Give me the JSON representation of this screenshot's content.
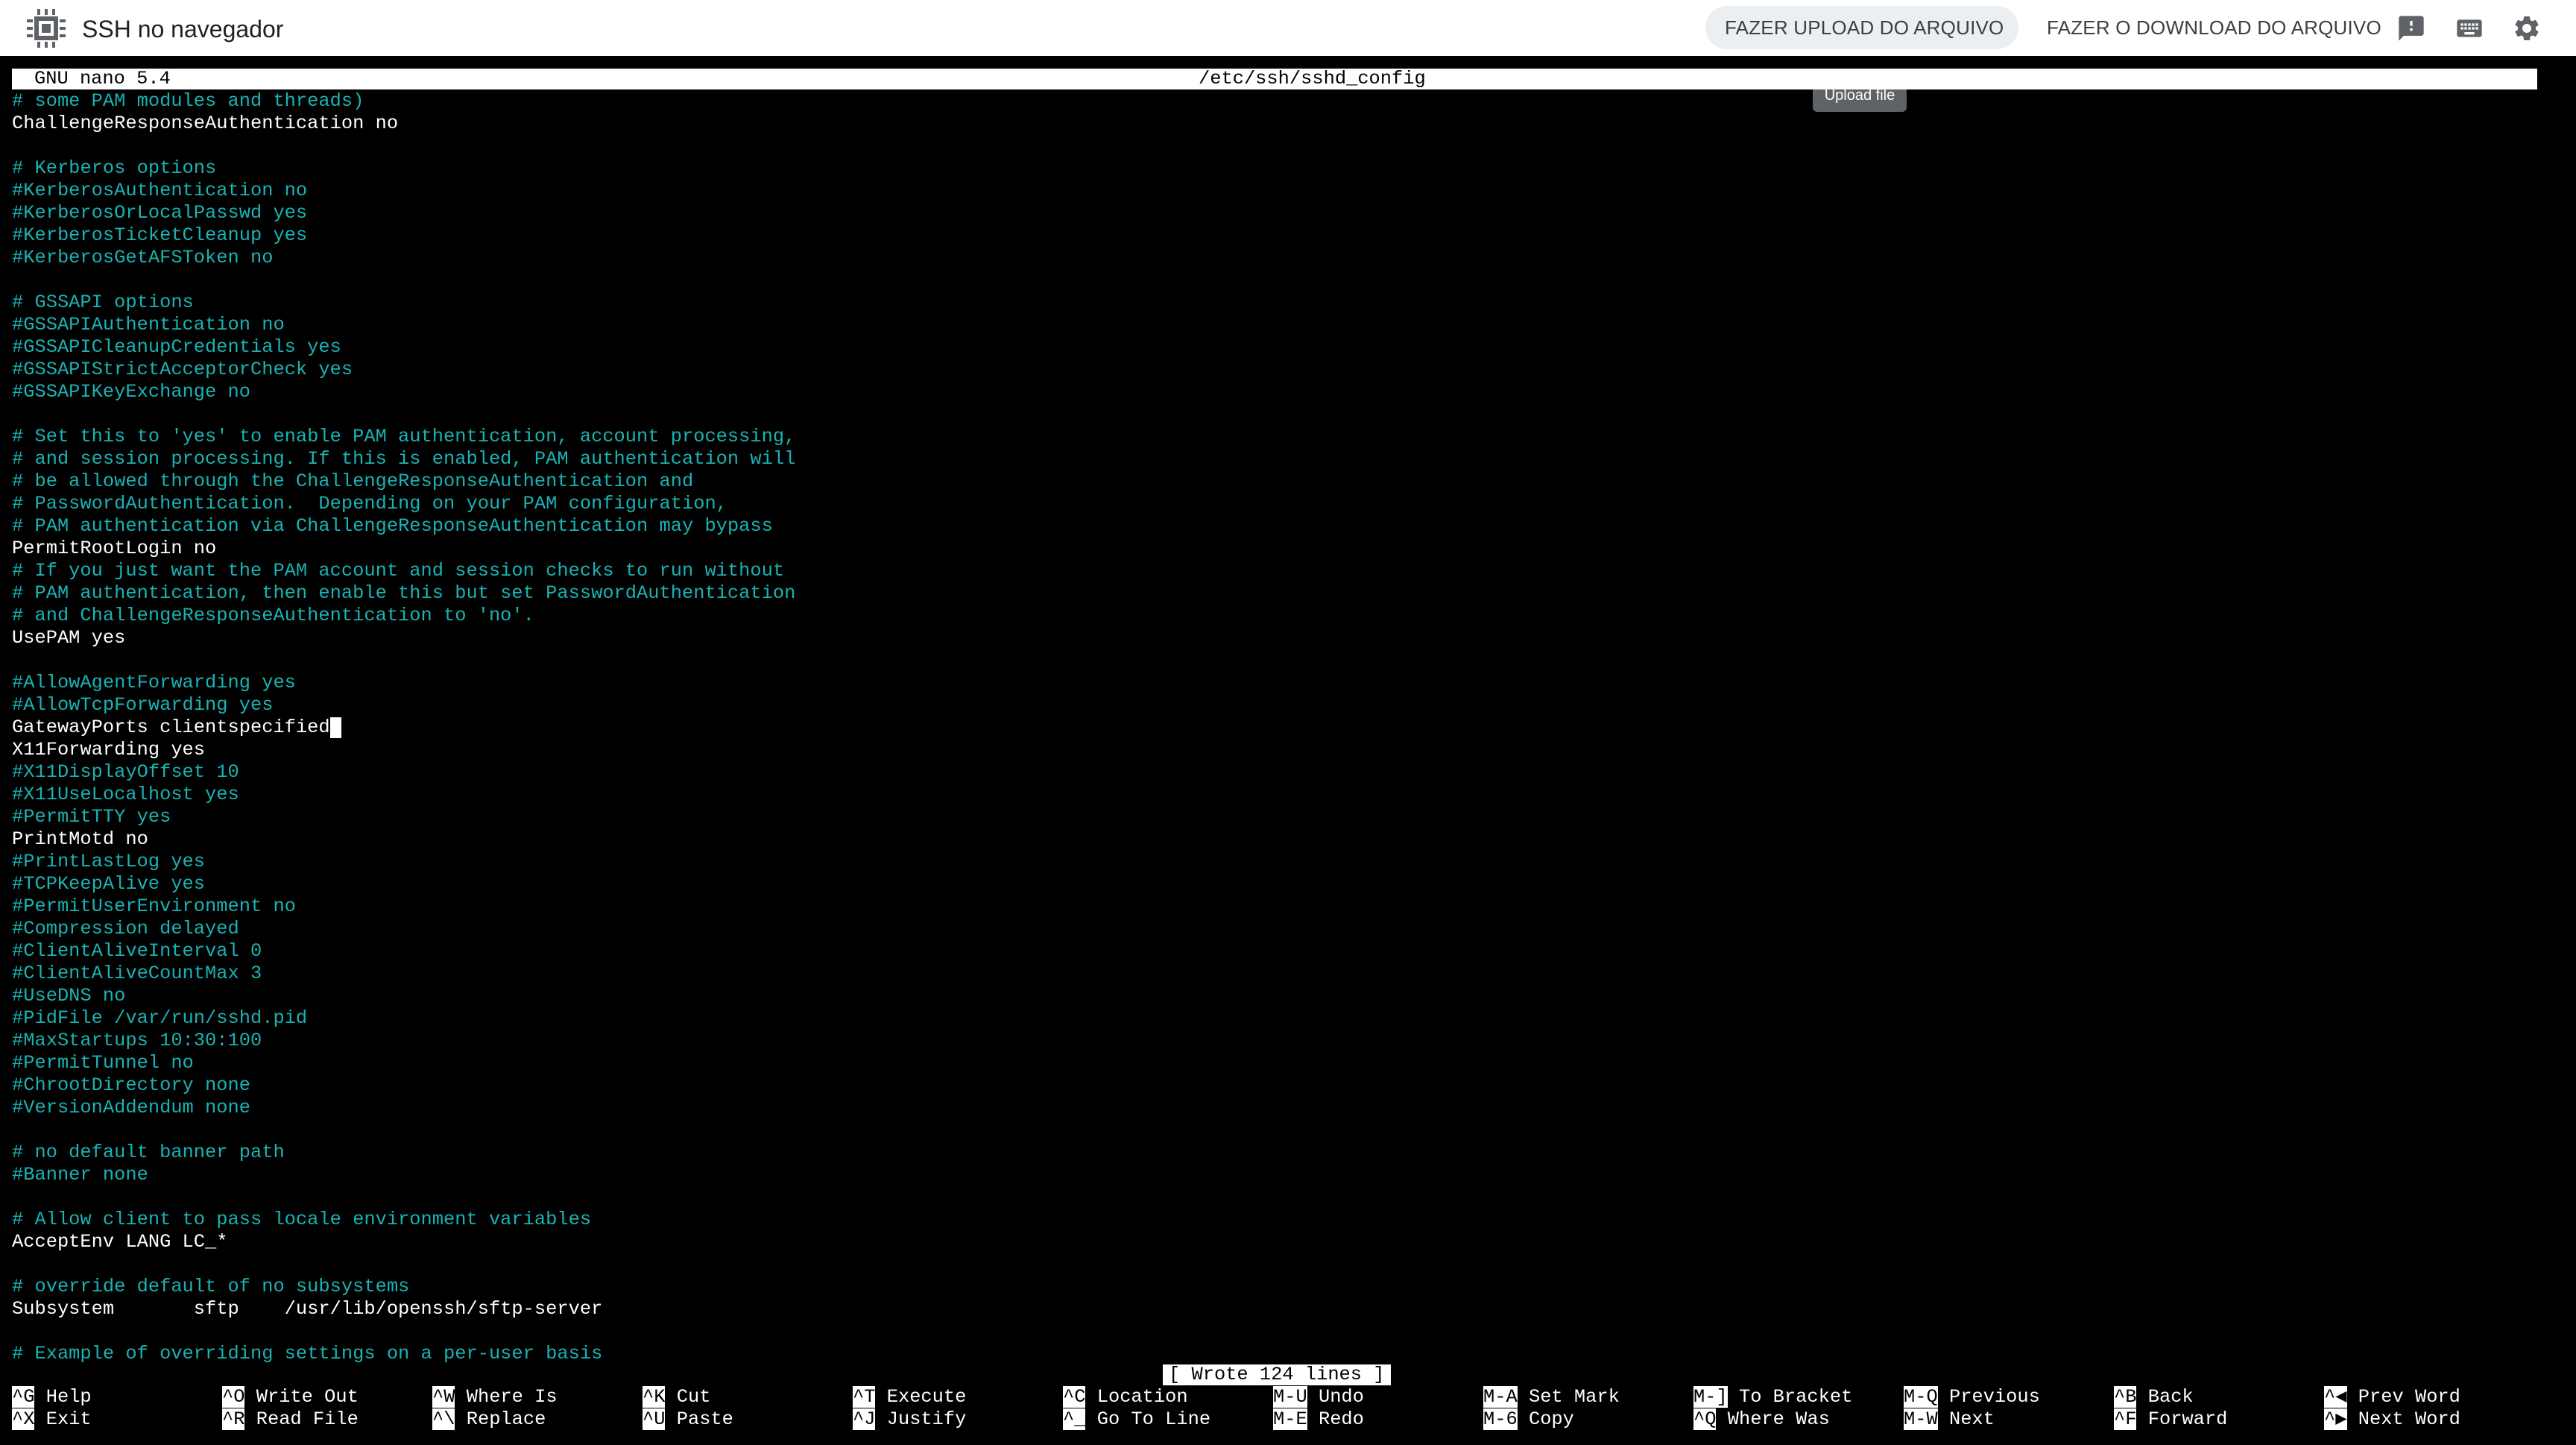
{
  "app": {
    "title": "SSH no navegador",
    "upload_label": "FAZER UPLOAD DO ARQUIVO",
    "download_label": "FAZER O DOWNLOAD DO ARQUIVO",
    "tooltip": "Upload file"
  },
  "nano": {
    "version": "GNU nano 5.4",
    "file": "/etc/ssh/sshd_config",
    "status": "[ Wrote 124 lines ]"
  },
  "lines": [
    {
      "t": "# some PAM modules and threads)",
      "c": true
    },
    {
      "t": "ChallengeResponseAuthentication no",
      "c": false
    },
    {
      "t": "",
      "c": false
    },
    {
      "t": "# Kerberos options",
      "c": true
    },
    {
      "t": "#KerberosAuthentication no",
      "c": true
    },
    {
      "t": "#KerberosOrLocalPasswd yes",
      "c": true
    },
    {
      "t": "#KerberosTicketCleanup yes",
      "c": true
    },
    {
      "t": "#KerberosGetAFSToken no",
      "c": true
    },
    {
      "t": "",
      "c": false
    },
    {
      "t": "# GSSAPI options",
      "c": true
    },
    {
      "t": "#GSSAPIAuthentication no",
      "c": true
    },
    {
      "t": "#GSSAPICleanupCredentials yes",
      "c": true
    },
    {
      "t": "#GSSAPIStrictAcceptorCheck yes",
      "c": true
    },
    {
      "t": "#GSSAPIKeyExchange no",
      "c": true
    },
    {
      "t": "",
      "c": false
    },
    {
      "t": "# Set this to 'yes' to enable PAM authentication, account processing,",
      "c": true
    },
    {
      "t": "# and session processing. If this is enabled, PAM authentication will",
      "c": true
    },
    {
      "t": "# be allowed through the ChallengeResponseAuthentication and",
      "c": true
    },
    {
      "t": "# PasswordAuthentication.  Depending on your PAM configuration,",
      "c": true
    },
    {
      "t": "# PAM authentication via ChallengeResponseAuthentication may bypass",
      "c": true
    },
    {
      "t": "PermitRootLogin no",
      "c": false
    },
    {
      "t": "# If you just want the PAM account and session checks to run without",
      "c": true
    },
    {
      "t": "# PAM authentication, then enable this but set PasswordAuthentication",
      "c": true
    },
    {
      "t": "# and ChallengeResponseAuthentication to 'no'.",
      "c": true
    },
    {
      "t": "UsePAM yes",
      "c": false
    },
    {
      "t": "",
      "c": false
    },
    {
      "t": "#AllowAgentForwarding yes",
      "c": true
    },
    {
      "t": "#AllowTcpForwarding yes",
      "c": true
    },
    {
      "t": "GatewayPorts clientspecified",
      "c": false,
      "cursor": true
    },
    {
      "t": "X11Forwarding yes",
      "c": false
    },
    {
      "t": "#X11DisplayOffset 10",
      "c": true
    },
    {
      "t": "#X11UseLocalhost yes",
      "c": true
    },
    {
      "t": "#PermitTTY yes",
      "c": true
    },
    {
      "t": "PrintMotd no",
      "c": false
    },
    {
      "t": "#PrintLastLog yes",
      "c": true
    },
    {
      "t": "#TCPKeepAlive yes",
      "c": true
    },
    {
      "t": "#PermitUserEnvironment no",
      "c": true
    },
    {
      "t": "#Compression delayed",
      "c": true
    },
    {
      "t": "#ClientAliveInterval 0",
      "c": true
    },
    {
      "t": "#ClientAliveCountMax 3",
      "c": true
    },
    {
      "t": "#UseDNS no",
      "c": true
    },
    {
      "t": "#PidFile /var/run/sshd.pid",
      "c": true
    },
    {
      "t": "#MaxStartups 10:30:100",
      "c": true
    },
    {
      "t": "#PermitTunnel no",
      "c": true
    },
    {
      "t": "#ChrootDirectory none",
      "c": true
    },
    {
      "t": "#VersionAddendum none",
      "c": true
    },
    {
      "t": "",
      "c": false
    },
    {
      "t": "# no default banner path",
      "c": true
    },
    {
      "t": "#Banner none",
      "c": true
    },
    {
      "t": "",
      "c": false
    },
    {
      "t": "# Allow client to pass locale environment variables",
      "c": true
    },
    {
      "t": "AcceptEnv LANG LC_*",
      "c": false
    },
    {
      "t": "",
      "c": false
    },
    {
      "t": "# override default of no subsystems",
      "c": true
    },
    {
      "t": "Subsystem       sftp    /usr/lib/openssh/sftp-server",
      "c": false
    },
    {
      "t": "",
      "c": false
    },
    {
      "t": "# Example of overriding settings on a per-user basis",
      "c": true
    }
  ],
  "shortcuts": [
    [
      {
        "key": "^G",
        "label": "Help"
      },
      {
        "key": "^X",
        "label": "Exit"
      }
    ],
    [
      {
        "key": "^O",
        "label": "Write Out"
      },
      {
        "key": "^R",
        "label": "Read File"
      }
    ],
    [
      {
        "key": "^W",
        "label": "Where Is"
      },
      {
        "key": "^\\",
        "label": "Replace"
      }
    ],
    [
      {
        "key": "^K",
        "label": "Cut"
      },
      {
        "key": "^U",
        "label": "Paste"
      }
    ],
    [
      {
        "key": "^T",
        "label": "Execute"
      },
      {
        "key": "^J",
        "label": "Justify"
      }
    ],
    [
      {
        "key": "^C",
        "label": "Location"
      },
      {
        "key": "^_",
        "label": "Go To Line"
      }
    ],
    [
      {
        "key": "M-U",
        "label": "Undo"
      },
      {
        "key": "M-E",
        "label": "Redo"
      }
    ],
    [
      {
        "key": "M-A",
        "label": "Set Mark"
      },
      {
        "key": "M-6",
        "label": "Copy"
      }
    ],
    [
      {
        "key": "M-]",
        "label": "To Bracket"
      },
      {
        "key": "^Q",
        "label": "Where Was"
      }
    ],
    [
      {
        "key": "M-Q",
        "label": "Previous"
      },
      {
        "key": "M-W",
        "label": "Next"
      }
    ],
    [
      {
        "key": "^B",
        "label": "Back"
      },
      {
        "key": "^F",
        "label": "Forward"
      }
    ],
    [
      {
        "key": "^◀",
        "label": "Prev Word"
      },
      {
        "key": "^▶",
        "label": "Next Word"
      }
    ]
  ]
}
